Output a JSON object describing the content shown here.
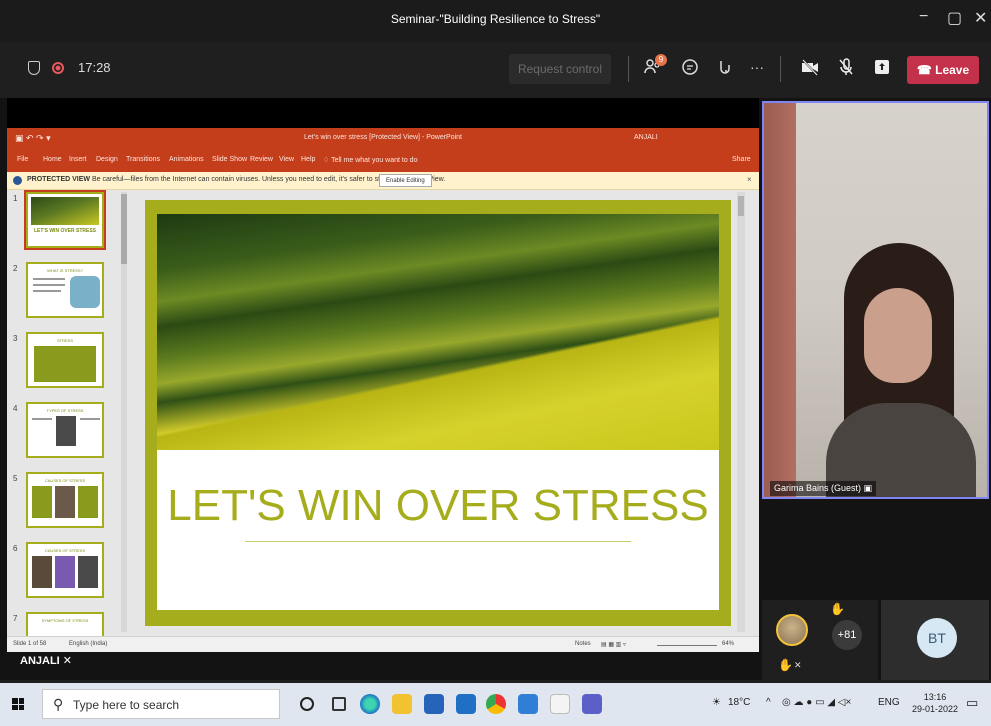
{
  "window": {
    "title": "Seminar-\"Building Resilience to Stress\"",
    "minimize": "−",
    "maximize": "▢",
    "close": "✕"
  },
  "meeting": {
    "timer": "17:28",
    "request_control": "Request control",
    "participants_badge": "9",
    "leave": "Leave",
    "more": "···"
  },
  "powerpoint": {
    "doc_title": "Let's win over stress [Protected View] - PowerPoint",
    "user": "ANJALI",
    "menu": [
      "File",
      "Home",
      "Insert",
      "Design",
      "Transitions",
      "Animations",
      "Slide Show",
      "Review",
      "View",
      "Help",
      "Tell me what you want to do"
    ],
    "share": "Share",
    "protected_view": {
      "label": "PROTECTED VIEW",
      "message": "Be careful—files from the Internet can contain viruses. Unless you need to edit, it's safer to stay in Protected View.",
      "button": "Enable Editing"
    },
    "thumbnails": [
      {
        "num": "1",
        "caption": "LET'S WIN OVER STRESS"
      },
      {
        "num": "2",
        "caption": "WHAT IS STRESS?"
      },
      {
        "num": "3",
        "caption": "STRESS"
      },
      {
        "num": "4",
        "caption": "TYPES OF STRESS"
      },
      {
        "num": "5",
        "caption": "CAUSES OF STRESS"
      },
      {
        "num": "6",
        "caption": "CAUSES OF STRESS"
      },
      {
        "num": "7",
        "caption": "SYMPTOMS OF STRESS"
      }
    ],
    "slide_headline": "LET'S WIN OVER STRESS",
    "status": {
      "slide_count": "Slide 1 of 58",
      "language": "English (India)",
      "notes": "Notes",
      "zoom": "64%"
    }
  },
  "presenter_label": "ANJALI",
  "video": {
    "name": "Garima Bains (Guest)"
  },
  "participants": {
    "overflow": "+81",
    "initials": "BT"
  },
  "taskbar": {
    "search_placeholder": "Type here to search",
    "temperature": "18°C",
    "language": "ENG",
    "time": "13:16",
    "date": "29-01-2022"
  }
}
